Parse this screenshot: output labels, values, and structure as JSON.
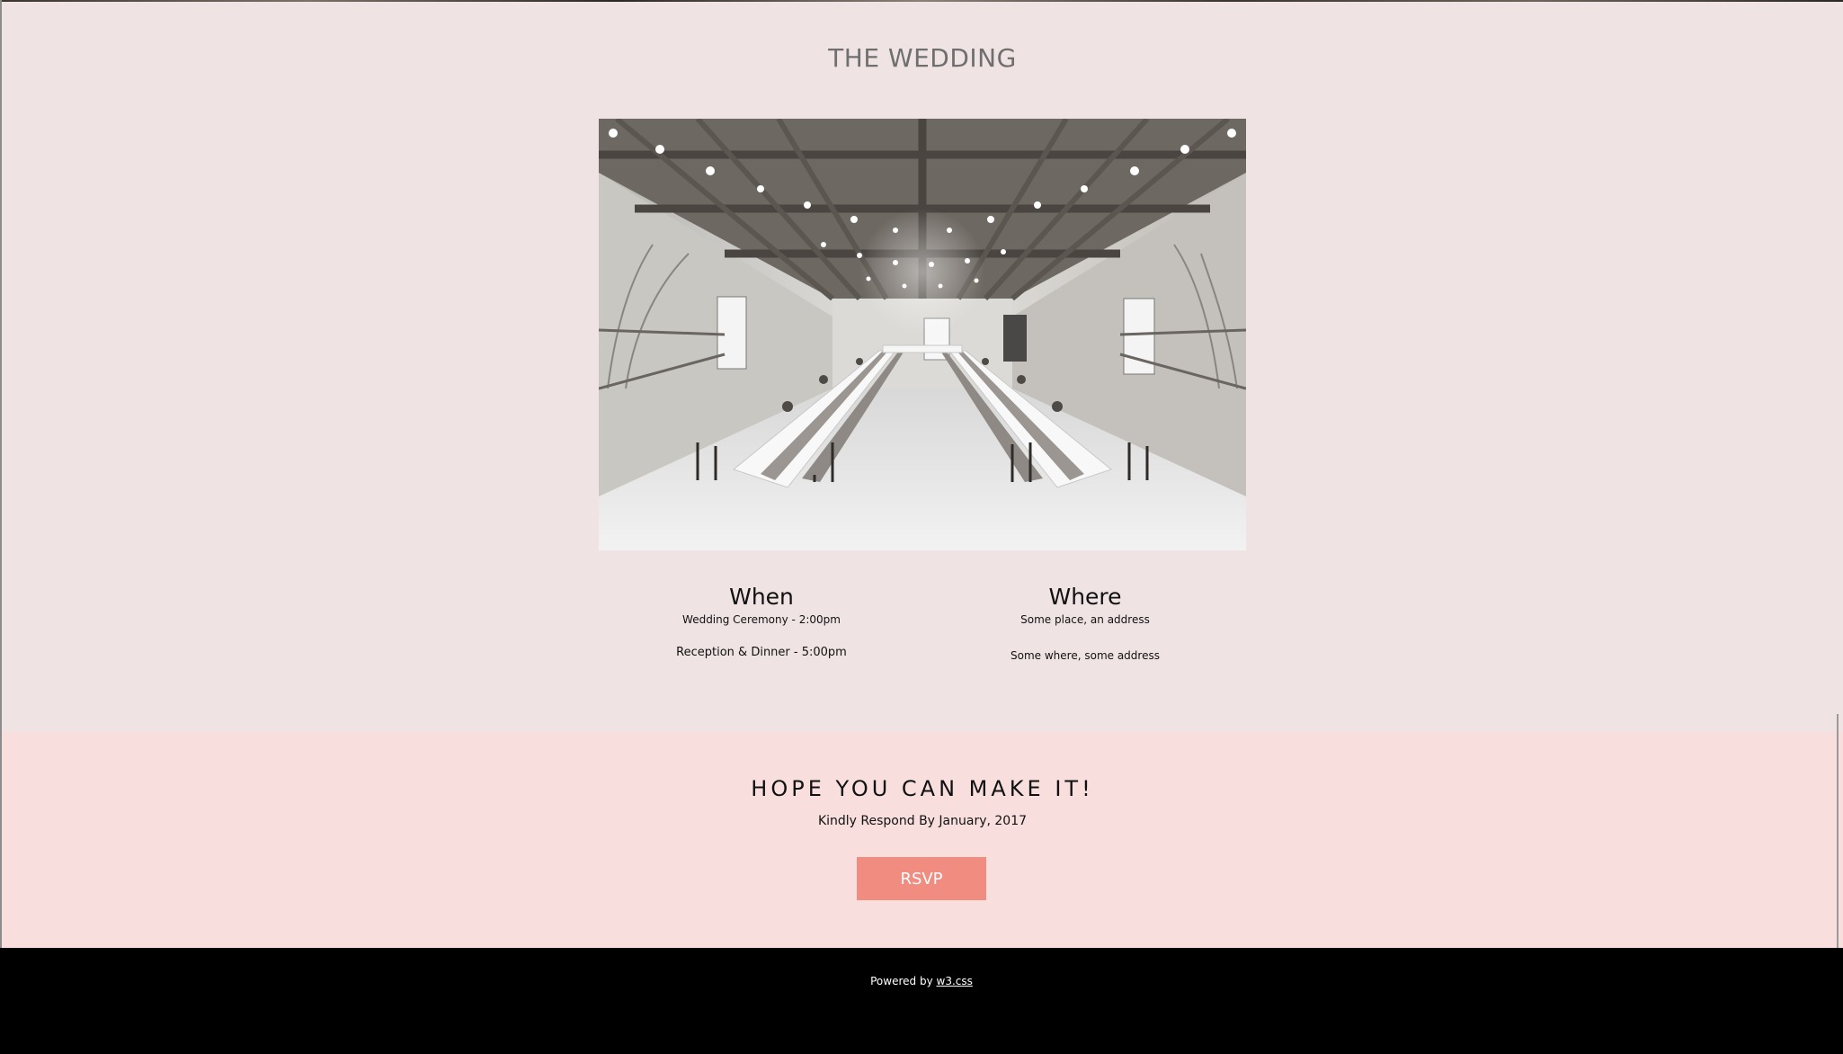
{
  "wedding": {
    "title": "THE WEDDING",
    "photo_alt": "Wedding reception hall with long tables and string lights",
    "when": {
      "heading": "When",
      "ceremony": "Wedding Ceremony - 2:00pm",
      "reception": "Reception & Dinner - 5:00pm"
    },
    "where": {
      "heading": "Where",
      "place1": "Some place, an address",
      "place2": "Some where, some address"
    }
  },
  "rsvp": {
    "heading": "HOPE YOU CAN MAKE IT!",
    "note": "Kindly Respond By January, 2017",
    "button_label": "RSVP"
  },
  "footer": {
    "prefix": "Powered by ",
    "link_label": "w3.css"
  },
  "colors": {
    "section_bg": "#efe3e3",
    "rsvp_bg": "#f9dede",
    "button_bg": "#f08c80",
    "footer_bg": "#000000"
  }
}
